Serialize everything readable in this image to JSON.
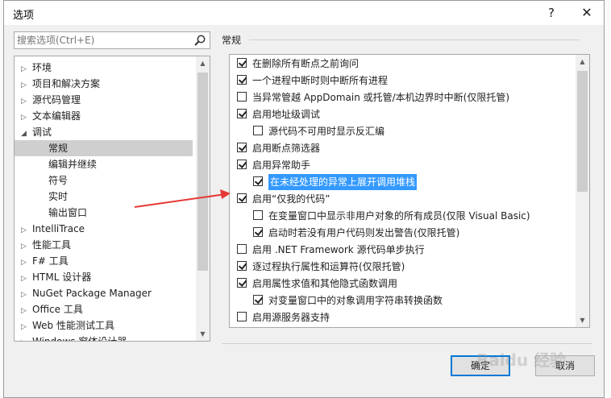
{
  "window": {
    "title": "选项",
    "help_label": "?",
    "close_label": "✕"
  },
  "search": {
    "placeholder": "搜索选项(Ctrl+E)"
  },
  "tree": {
    "items": [
      {
        "label": "环境",
        "expanded": false
      },
      {
        "label": "项目和解决方案",
        "expanded": false
      },
      {
        "label": "源代码管理",
        "expanded": false
      },
      {
        "label": "文本编辑器",
        "expanded": false
      },
      {
        "label": "调试",
        "expanded": true
      },
      {
        "label": "常规",
        "selected": true
      },
      {
        "label": "编辑并继续"
      },
      {
        "label": "符号"
      },
      {
        "label": "实时"
      },
      {
        "label": "输出窗口"
      },
      {
        "label": "IntelliTrace",
        "expanded": false
      },
      {
        "label": "性能工具",
        "expanded": false
      },
      {
        "label": "F# 工具",
        "expanded": false
      },
      {
        "label": "HTML 设计器",
        "expanded": false
      },
      {
        "label": "NuGet Package Manager",
        "expanded": false
      },
      {
        "label": "Office 工具",
        "expanded": false
      },
      {
        "label": "Web 性能测试工具",
        "expanded": false
      },
      {
        "label": "Windows 窗体设计器",
        "expanded": false
      }
    ]
  },
  "section": {
    "title": "常规"
  },
  "options": [
    {
      "label": "在删除所有断点之前询问",
      "checked": true,
      "indent": 0
    },
    {
      "label": "一个进程中断时则中断所有进程",
      "checked": true,
      "indent": 0
    },
    {
      "label": "当异常管越 AppDomain 或托管/本机边界时中断(仅限托管)",
      "checked": false,
      "indent": 0
    },
    {
      "label": "启用地址级调试",
      "checked": true,
      "indent": 0
    },
    {
      "label": "源代码不可用时显示反汇编",
      "checked": false,
      "indent": 1
    },
    {
      "label": "启用断点筛选器",
      "checked": true,
      "indent": 0
    },
    {
      "label": "启用异常助手",
      "checked": true,
      "indent": 0
    },
    {
      "label": "在未经处理的异常上展开调用堆栈",
      "checked": true,
      "indent": 1,
      "highlighted": true
    },
    {
      "label": "启用“仅我的代码”",
      "checked": true,
      "indent": 0
    },
    {
      "label": "在变量窗口中显示非用户对象的所有成员(仅限 Visual Basic)",
      "checked": false,
      "indent": 1
    },
    {
      "label": "启动时若没有用户代码则发出警告(仅限托管)",
      "checked": true,
      "indent": 1
    },
    {
      "label": "启用 .NET Framework 源代码单步执行",
      "checked": false,
      "indent": 0
    },
    {
      "label": "逐过程执行属性和运算符(仅限托管)",
      "checked": true,
      "indent": 0
    },
    {
      "label": "启用属性求值和其他隐式函数调用",
      "checked": true,
      "indent": 0
    },
    {
      "label": "对变量窗口中的对象调用字符串转换函数",
      "checked": true,
      "indent": 1
    },
    {
      "label": "启用源服务器支持",
      "checked": false,
      "indent": 0
    }
  ],
  "buttons": {
    "ok": "确定",
    "cancel": "取消"
  },
  "watermark": "Baidu 经验",
  "colors": {
    "accent": "#0078d7",
    "highlight": "#3399ff",
    "annotation_arrow": "#e53935"
  }
}
